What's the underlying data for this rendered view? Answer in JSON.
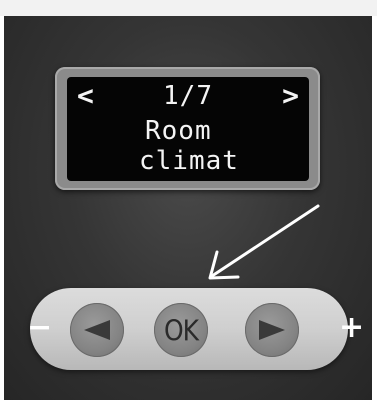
{
  "display": {
    "nav_left": "<",
    "counter": "1/7",
    "nav_right": ">",
    "line1": "Room",
    "line2": "climat"
  },
  "keypad": {
    "minus": "−",
    "ok_label": "OK",
    "plus": "+"
  },
  "icons": {
    "left_button": "triangle-left-icon",
    "right_button": "triangle-right-icon",
    "pointer": "annotation-arrow-icon"
  },
  "colors": {
    "screen_background": "#050505",
    "screen_text": "#f4f4f4",
    "panel": "#d0d0d0",
    "button": "#848484"
  }
}
